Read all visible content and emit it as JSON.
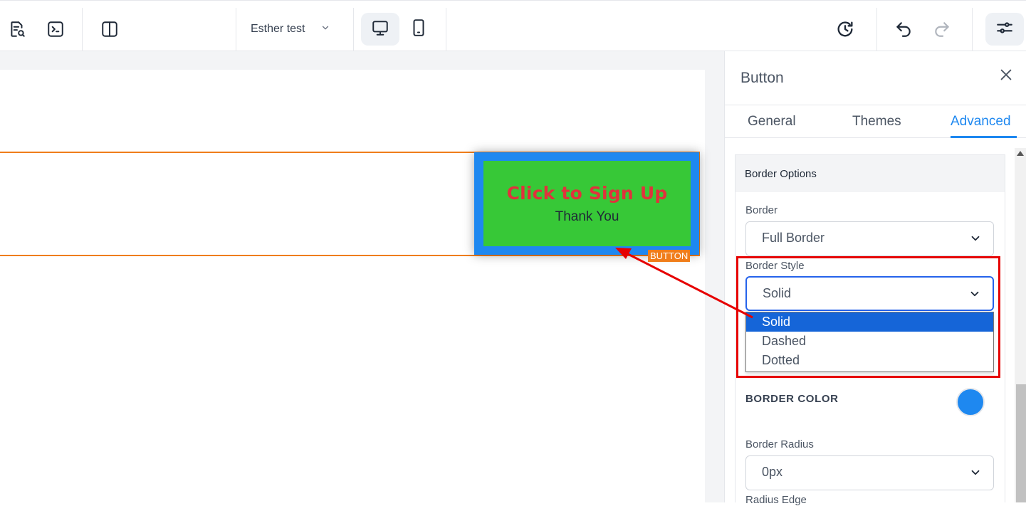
{
  "toolbar": {
    "page_name": "Esther test",
    "icons": [
      "page-search-icon",
      "terminal-icon",
      "split-view-icon",
      "chevron-down-icon",
      "desktop-icon",
      "mobile-icon",
      "history-icon",
      "undo-icon",
      "redo-icon",
      "settings-sliders-icon"
    ]
  },
  "canvas": {
    "button_text": "Click to Sign Up",
    "button_subtext": "Thank You",
    "element_tag": "BUTTON",
    "colors": {
      "button_border": "#1e88f0",
      "button_fill": "#37c837",
      "button_text": "#e0323c",
      "section_outline": "#ef7d1a"
    }
  },
  "panel": {
    "title": "Button",
    "tabs": [
      {
        "label": "General",
        "active": false
      },
      {
        "label": "Themes",
        "active": false
      },
      {
        "label": "Advanced",
        "active": true
      }
    ],
    "group_title": "Border Options",
    "border": {
      "label": "Border",
      "value": "Full Border"
    },
    "border_style": {
      "label": "Border Style",
      "value": "Solid",
      "options": [
        "Solid",
        "Dashed",
        "Dotted"
      ],
      "highlighted": "Solid"
    },
    "border_color": {
      "label": "BORDER COLOR",
      "value": "#1e88f0"
    },
    "border_radius": {
      "label": "Border Radius",
      "value": "0px"
    },
    "radius_edge": {
      "label": "Radius Edge"
    }
  },
  "annotation": {
    "highlight_color": "#e60000"
  }
}
